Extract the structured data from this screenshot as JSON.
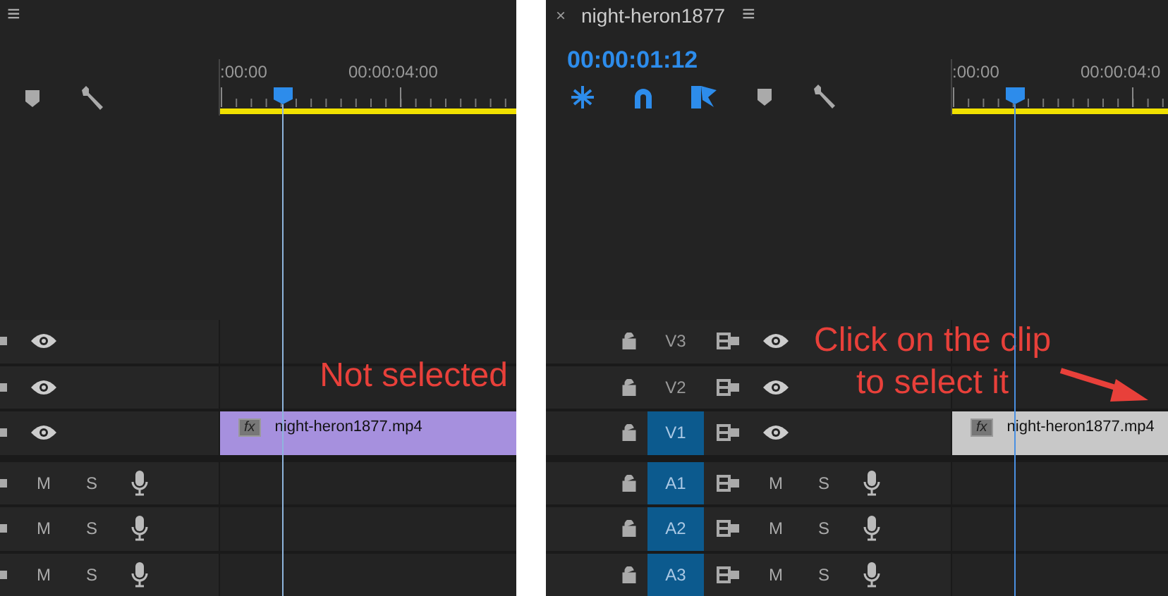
{
  "panels": [
    {
      "menu": "≡",
      "tools": [
        {
          "kind": "marker",
          "on": false
        },
        {
          "kind": "wrench",
          "on": false
        }
      ],
      "ruler": [
        ":00:00",
        "00:00:04:00"
      ],
      "tracks": [
        {
          "kind": "video"
        },
        {
          "kind": "video"
        },
        {
          "kind": "video"
        },
        {
          "kind": "audio",
          "mute": "M",
          "solo": "S"
        },
        {
          "kind": "audio",
          "mute": "M",
          "solo": "S"
        },
        {
          "kind": "audio",
          "mute": "M",
          "solo": "S"
        }
      ],
      "clip": {
        "name": "night-heron1877.mp4",
        "fx": "fx",
        "selected": false
      },
      "annotation": {
        "text": "Not selected",
        "arrow": false
      }
    },
    {
      "close": "×",
      "title": "night-heron1877",
      "menu": "≡",
      "timecode": "00:00:01:12",
      "tools": [
        {
          "kind": "ripple",
          "on": true
        },
        {
          "kind": "magnet",
          "on": true
        },
        {
          "kind": "linked",
          "on": true
        },
        {
          "kind": "marker",
          "on": false
        },
        {
          "kind": "wrench",
          "on": false
        }
      ],
      "ruler": [
        ":00:00",
        "00:00:04:0"
      ],
      "tracks": [
        {
          "kind": "video",
          "label": "V3",
          "targeted": false
        },
        {
          "kind": "video",
          "label": "V2",
          "targeted": false
        },
        {
          "kind": "video",
          "label": "V1",
          "targeted": true
        },
        {
          "kind": "audio",
          "label": "A1",
          "targeted": true,
          "mute": "M",
          "solo": "S"
        },
        {
          "kind": "audio",
          "label": "A2",
          "targeted": true,
          "mute": "M",
          "solo": "S"
        },
        {
          "kind": "audio",
          "label": "A3",
          "targeted": true,
          "mute": "M",
          "solo": "S"
        }
      ],
      "clip": {
        "name": "night-heron1877.mp4",
        "fx": "fx",
        "selected": true
      },
      "annotation": {
        "text": "Click on the clip\nto select it",
        "arrow": true
      }
    }
  ]
}
